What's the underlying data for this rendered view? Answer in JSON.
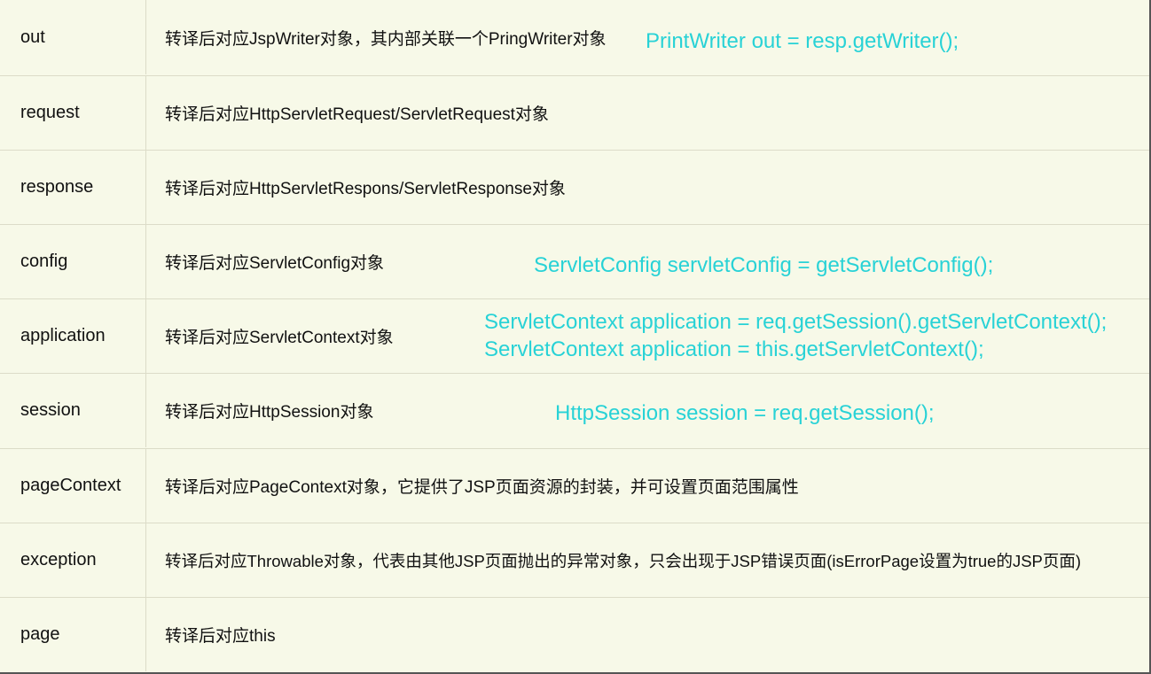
{
  "rows": [
    {
      "name": "out",
      "desc": "转译后对应JspWriter对象，其内部关联一个PringWriter对象"
    },
    {
      "name": "request",
      "desc": "转译后对应HttpServletRequest/ServletRequest对象"
    },
    {
      "name": "response",
      "desc": "转译后对应HttpServletRespons/ServletResponse对象"
    },
    {
      "name": "config",
      "desc": "转译后对应ServletConfig对象"
    },
    {
      "name": "application",
      "desc": "转译后对应ServletContext对象"
    },
    {
      "name": "session",
      "desc": "转译后对应HttpSession对象"
    },
    {
      "name": "pageContext",
      "desc": "转译后对应PageContext对象，它提供了JSP页面资源的封装，并可设置页面范围属性"
    },
    {
      "name": "exception",
      "desc": "转译后对应Throwable对象，代表由其他JSP页面抛出的异常对象，只会出现于JSP错误页面(isErrorPage设置为true的JSP页面)"
    },
    {
      "name": "page",
      "desc": "转译后对应this"
    }
  ],
  "notes": {
    "out": "PrintWriter out = resp.getWriter();",
    "config": "ServletConfig servletConfig = getServletConfig();",
    "application_1": "ServletContext application = req.getSession().getServletContext();",
    "application_2": "ServletContext application = this.getServletContext();",
    "session": "HttpSession session = req.getSession();"
  },
  "colors": {
    "background": "#f7f9e8",
    "annotation": "#28d2d6",
    "text": "#111111"
  }
}
